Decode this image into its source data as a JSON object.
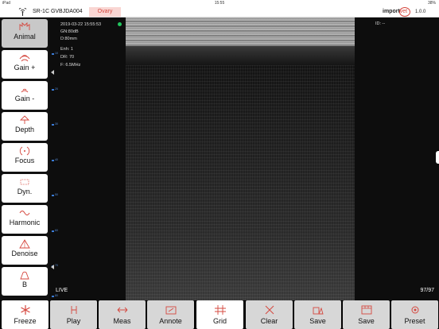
{
  "status_bar": {
    "device": "iPad",
    "time": "15:55",
    "battery": "38%"
  },
  "header": {
    "device_id": "SR-1C GVBJDA004",
    "mode": "Ovary",
    "logo_main": "import",
    "logo_accent": "vet",
    "version": "1.0.0"
  },
  "info": {
    "datetime": "2019-03-22 15:55:53",
    "gain": "GN:80dB",
    "depth": "D:80mm",
    "enhance": "Enh: 1",
    "dynamic_range": "DR: 70",
    "frequency": "F: 6.5MHz",
    "live": "LIVE",
    "id": "ID: --",
    "frames": "97/97"
  },
  "scale_ticks": [
    "10",
    "20",
    "30",
    "40",
    "50",
    "60",
    "70",
    "80"
  ],
  "sidebar": {
    "items": [
      {
        "label": "Animal",
        "icon": "animal-icon"
      },
      {
        "label": "Gain +",
        "icon": "gain-plus-icon"
      },
      {
        "label": "Gain -",
        "icon": "gain-minus-icon"
      },
      {
        "label": "Depth",
        "icon": "depth-icon"
      },
      {
        "label": "Focus",
        "icon": "focus-icon"
      },
      {
        "label": "Dyn.",
        "icon": "dynamic-range-icon"
      },
      {
        "label": "Harmonic",
        "icon": "harmonic-icon"
      },
      {
        "label": "Denoise",
        "icon": "denoise-icon"
      },
      {
        "label": "B",
        "icon": "b-mode-icon"
      }
    ]
  },
  "toolbar": {
    "items": [
      {
        "label": "Freeze",
        "icon": "snowflake-icon"
      },
      {
        "label": "Play",
        "icon": "play-icon"
      },
      {
        "label": "Meas",
        "icon": "measure-icon"
      },
      {
        "label": "Annote",
        "icon": "annotate-icon"
      },
      {
        "label": "Grid",
        "icon": "grid-icon"
      },
      {
        "label": "Clear",
        "icon": "clear-icon"
      },
      {
        "label": "Save",
        "icon": "save-image-icon"
      },
      {
        "label": "Save",
        "icon": "save-cine-icon"
      },
      {
        "label": "Preset",
        "icon": "preset-icon"
      }
    ]
  },
  "colors": {
    "accent": "#d5473e",
    "tick": "#3a7bd5",
    "status_dot": "#22c55e"
  }
}
